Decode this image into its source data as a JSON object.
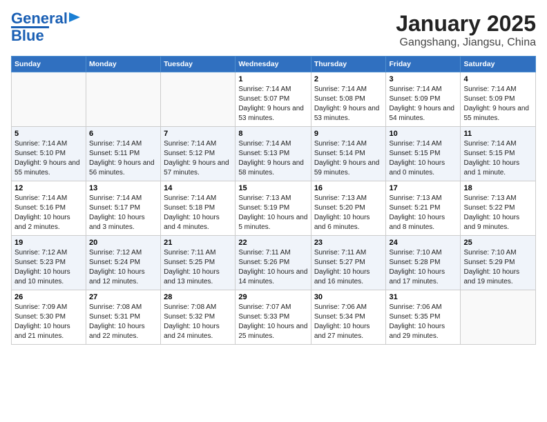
{
  "logo": {
    "line1": "General",
    "line2": "Blue"
  },
  "title": "January 2025",
  "subtitle": "Gangshang, Jiangsu, China",
  "weekdays": [
    "Sunday",
    "Monday",
    "Tuesday",
    "Wednesday",
    "Thursday",
    "Friday",
    "Saturday"
  ],
  "weeks": [
    [
      {
        "day": "",
        "info": ""
      },
      {
        "day": "",
        "info": ""
      },
      {
        "day": "",
        "info": ""
      },
      {
        "day": "1",
        "info": "Sunrise: 7:14 AM\nSunset: 5:07 PM\nDaylight: 9 hours and 53 minutes."
      },
      {
        "day": "2",
        "info": "Sunrise: 7:14 AM\nSunset: 5:08 PM\nDaylight: 9 hours and 53 minutes."
      },
      {
        "day": "3",
        "info": "Sunrise: 7:14 AM\nSunset: 5:09 PM\nDaylight: 9 hours and 54 minutes."
      },
      {
        "day": "4",
        "info": "Sunrise: 7:14 AM\nSunset: 5:09 PM\nDaylight: 9 hours and 55 minutes."
      }
    ],
    [
      {
        "day": "5",
        "info": "Sunrise: 7:14 AM\nSunset: 5:10 PM\nDaylight: 9 hours and 55 minutes."
      },
      {
        "day": "6",
        "info": "Sunrise: 7:14 AM\nSunset: 5:11 PM\nDaylight: 9 hours and 56 minutes."
      },
      {
        "day": "7",
        "info": "Sunrise: 7:14 AM\nSunset: 5:12 PM\nDaylight: 9 hours and 57 minutes."
      },
      {
        "day": "8",
        "info": "Sunrise: 7:14 AM\nSunset: 5:13 PM\nDaylight: 9 hours and 58 minutes."
      },
      {
        "day": "9",
        "info": "Sunrise: 7:14 AM\nSunset: 5:14 PM\nDaylight: 9 hours and 59 minutes."
      },
      {
        "day": "10",
        "info": "Sunrise: 7:14 AM\nSunset: 5:15 PM\nDaylight: 10 hours and 0 minutes."
      },
      {
        "day": "11",
        "info": "Sunrise: 7:14 AM\nSunset: 5:15 PM\nDaylight: 10 hours and 1 minute."
      }
    ],
    [
      {
        "day": "12",
        "info": "Sunrise: 7:14 AM\nSunset: 5:16 PM\nDaylight: 10 hours and 2 minutes."
      },
      {
        "day": "13",
        "info": "Sunrise: 7:14 AM\nSunset: 5:17 PM\nDaylight: 10 hours and 3 minutes."
      },
      {
        "day": "14",
        "info": "Sunrise: 7:14 AM\nSunset: 5:18 PM\nDaylight: 10 hours and 4 minutes."
      },
      {
        "day": "15",
        "info": "Sunrise: 7:13 AM\nSunset: 5:19 PM\nDaylight: 10 hours and 5 minutes."
      },
      {
        "day": "16",
        "info": "Sunrise: 7:13 AM\nSunset: 5:20 PM\nDaylight: 10 hours and 6 minutes."
      },
      {
        "day": "17",
        "info": "Sunrise: 7:13 AM\nSunset: 5:21 PM\nDaylight: 10 hours and 8 minutes."
      },
      {
        "day": "18",
        "info": "Sunrise: 7:13 AM\nSunset: 5:22 PM\nDaylight: 10 hours and 9 minutes."
      }
    ],
    [
      {
        "day": "19",
        "info": "Sunrise: 7:12 AM\nSunset: 5:23 PM\nDaylight: 10 hours and 10 minutes."
      },
      {
        "day": "20",
        "info": "Sunrise: 7:12 AM\nSunset: 5:24 PM\nDaylight: 10 hours and 12 minutes."
      },
      {
        "day": "21",
        "info": "Sunrise: 7:11 AM\nSunset: 5:25 PM\nDaylight: 10 hours and 13 minutes."
      },
      {
        "day": "22",
        "info": "Sunrise: 7:11 AM\nSunset: 5:26 PM\nDaylight: 10 hours and 14 minutes."
      },
      {
        "day": "23",
        "info": "Sunrise: 7:11 AM\nSunset: 5:27 PM\nDaylight: 10 hours and 16 minutes."
      },
      {
        "day": "24",
        "info": "Sunrise: 7:10 AM\nSunset: 5:28 PM\nDaylight: 10 hours and 17 minutes."
      },
      {
        "day": "25",
        "info": "Sunrise: 7:10 AM\nSunset: 5:29 PM\nDaylight: 10 hours and 19 minutes."
      }
    ],
    [
      {
        "day": "26",
        "info": "Sunrise: 7:09 AM\nSunset: 5:30 PM\nDaylight: 10 hours and 21 minutes."
      },
      {
        "day": "27",
        "info": "Sunrise: 7:08 AM\nSunset: 5:31 PM\nDaylight: 10 hours and 22 minutes."
      },
      {
        "day": "28",
        "info": "Sunrise: 7:08 AM\nSunset: 5:32 PM\nDaylight: 10 hours and 24 minutes."
      },
      {
        "day": "29",
        "info": "Sunrise: 7:07 AM\nSunset: 5:33 PM\nDaylight: 10 hours and 25 minutes."
      },
      {
        "day": "30",
        "info": "Sunrise: 7:06 AM\nSunset: 5:34 PM\nDaylight: 10 hours and 27 minutes."
      },
      {
        "day": "31",
        "info": "Sunrise: 7:06 AM\nSunset: 5:35 PM\nDaylight: 10 hours and 29 minutes."
      },
      {
        "day": "",
        "info": ""
      }
    ]
  ]
}
